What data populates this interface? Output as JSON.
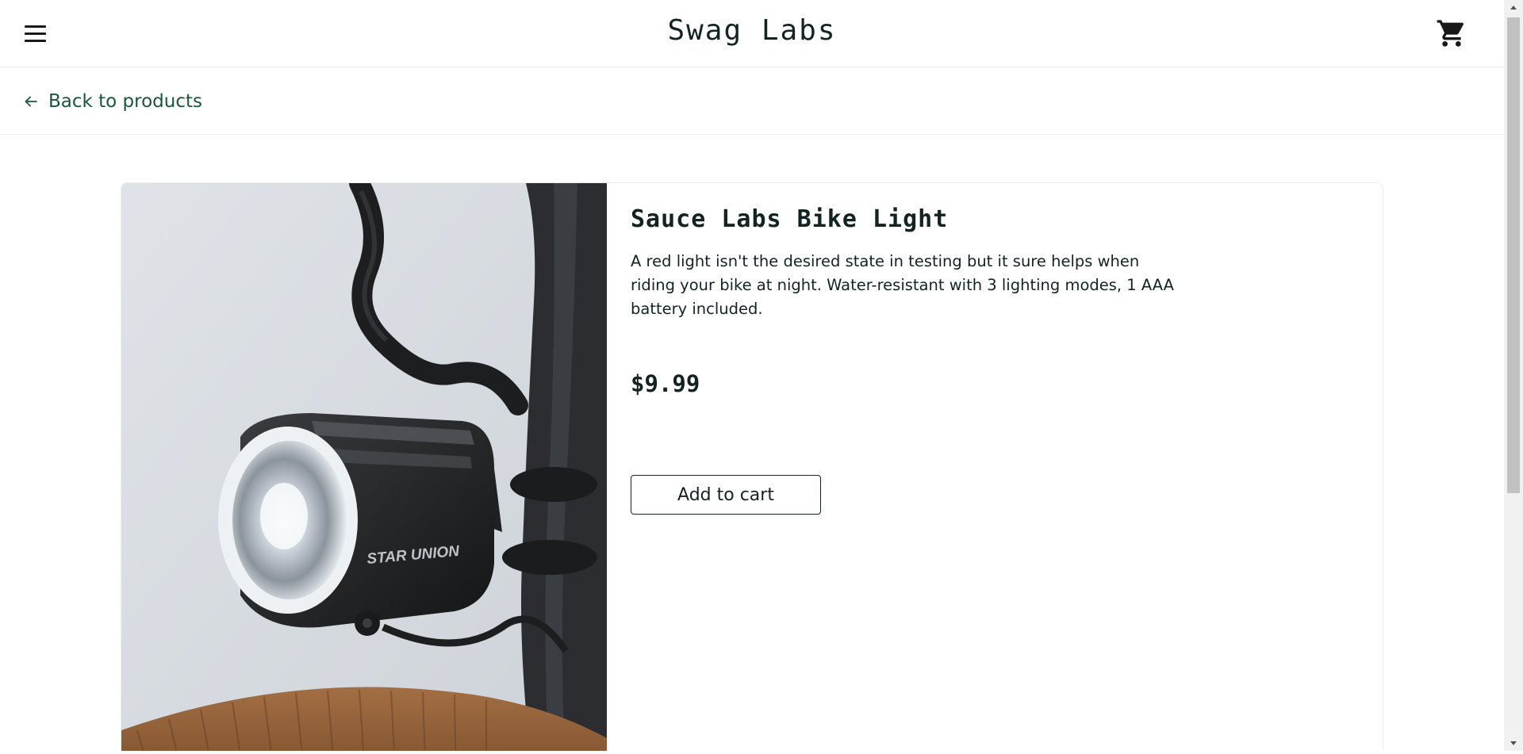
{
  "header": {
    "app_title": "Swag Labs",
    "menu_icon": "hamburger-menu-icon",
    "cart_icon": "shopping-cart-icon"
  },
  "subheader": {
    "back_label": "Back to products",
    "back_icon": "arrow-left-icon"
  },
  "product": {
    "name": "Sauce Labs Bike Light",
    "description": "A red light isn't the desired state in testing but it sure helps when riding your bike at night. Water-resistant with 3 lighting modes, 1 AAA battery included.",
    "price": "$9.99",
    "add_to_cart_label": "Add to cart",
    "image_brand_text": "STAR UNION"
  },
  "colors": {
    "text": "#132322",
    "link_green": "#18583a",
    "border": "#ededed"
  }
}
